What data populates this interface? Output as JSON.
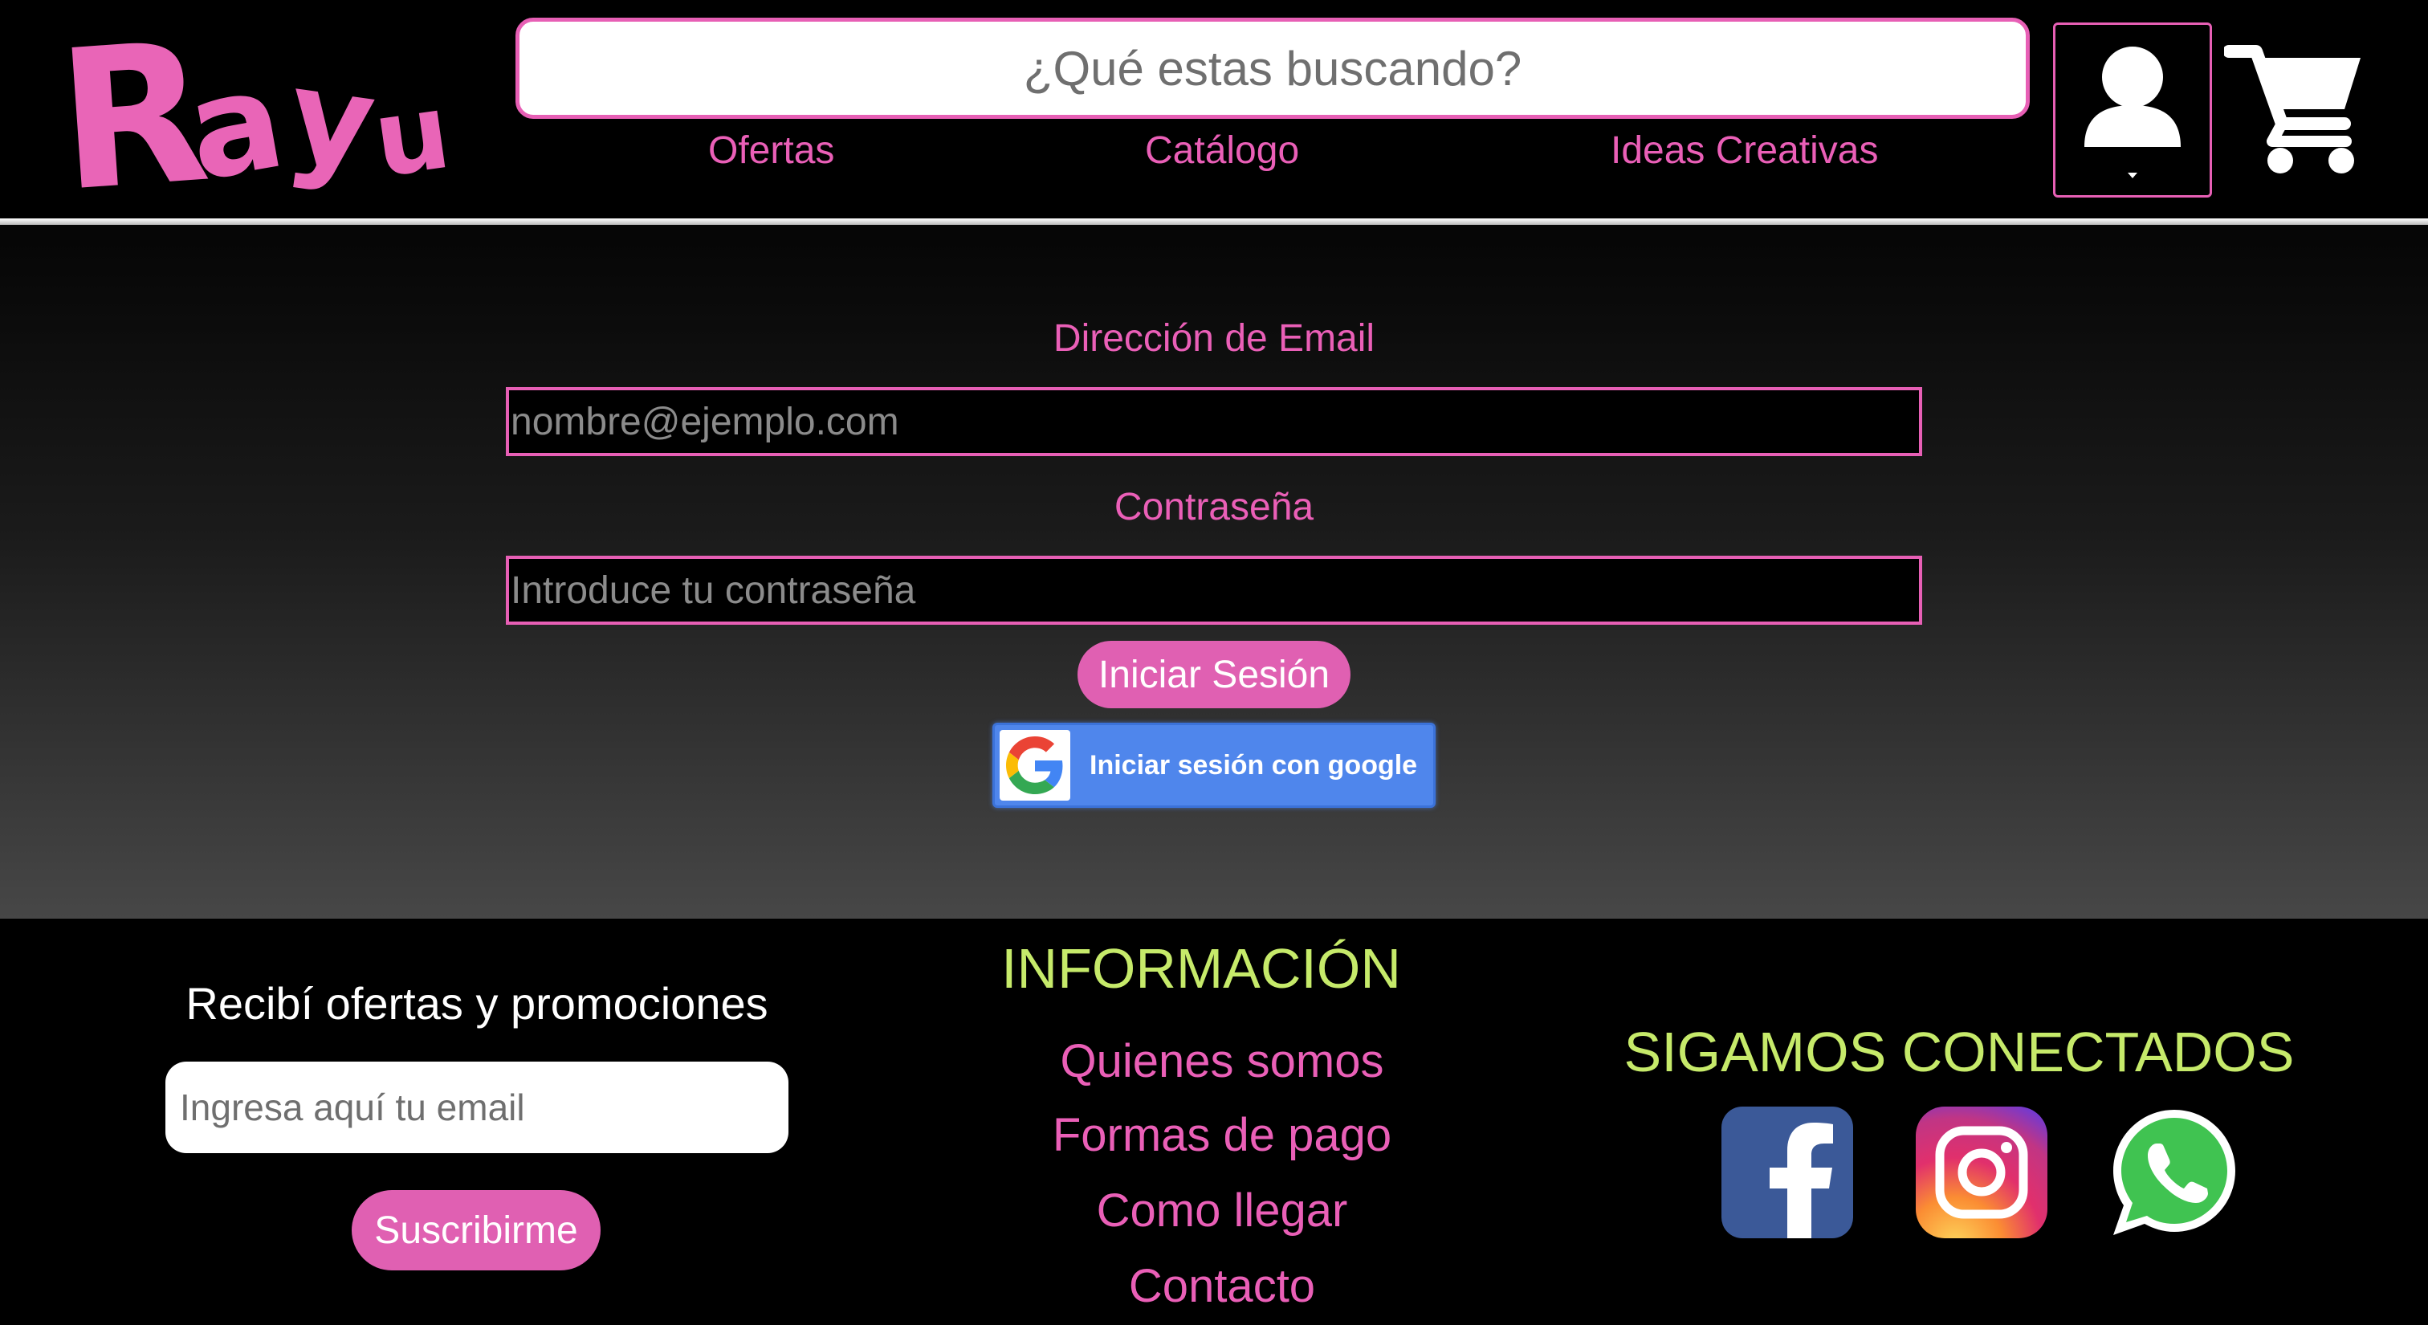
{
  "brand": {
    "logo_text": "Rayu",
    "accent_color": "#e75fb5",
    "highlight_color": "#c6ea6a"
  },
  "header": {
    "search": {
      "placeholder": "¿Qué estas buscando?"
    },
    "nav": {
      "ofertas": "Ofertas",
      "catalogo": "Catálogo",
      "ideas": "Ideas Creativas"
    },
    "icons": [
      "user-icon",
      "cart-icon"
    ]
  },
  "login": {
    "email_label": "Dirección de Email",
    "email_placeholder": "nombre@ejemplo.com",
    "password_label": "Contraseña",
    "password_placeholder": "Introduce tu contraseña",
    "submit_label": "Iniciar Sesión",
    "google_label": "Iniciar sesión con google",
    "google_color": "#4f86ec"
  },
  "footer": {
    "newsletter": {
      "title": "Recibí ofertas y promociones",
      "placeholder": "Ingresa aquí tu email",
      "button_label": "Suscribirme"
    },
    "info": {
      "title": "INFORMACIÓN",
      "links": [
        "Quienes somos",
        "Formas de pago",
        "Como llegar",
        "Contacto"
      ]
    },
    "social": {
      "title": "SIGAMOS CONECTADOS",
      "icons": [
        "facebook-icon",
        "instagram-icon",
        "whatsapp-icon"
      ]
    }
  }
}
